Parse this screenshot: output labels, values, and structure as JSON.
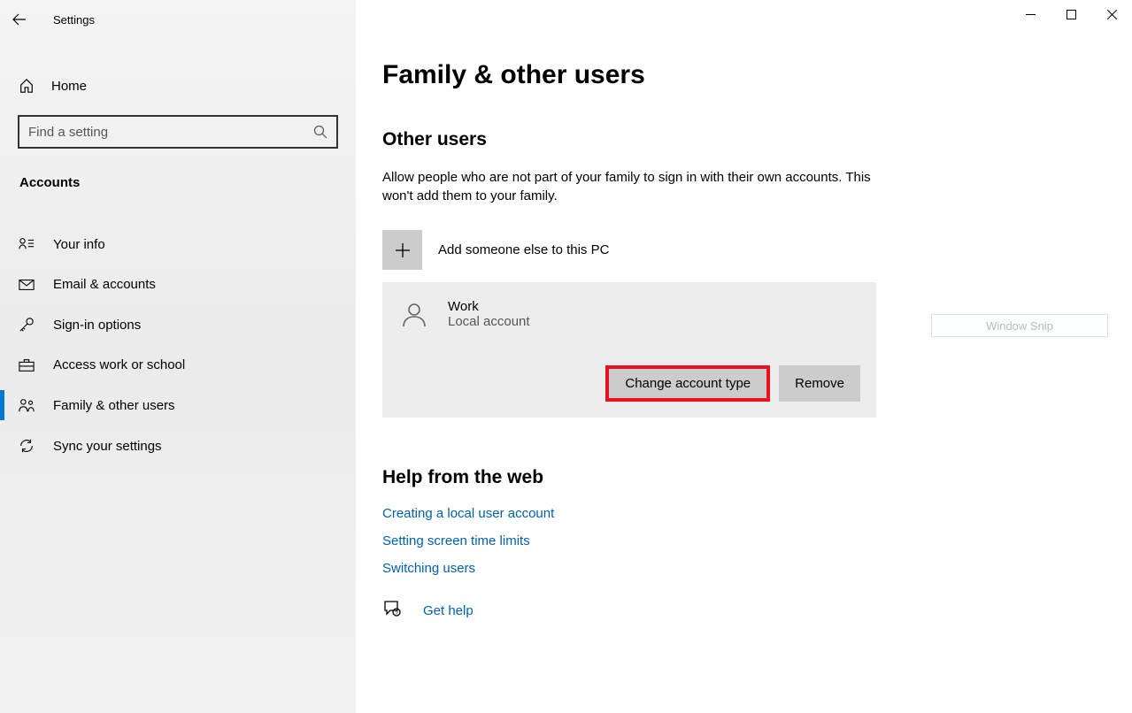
{
  "app": {
    "title": "Settings"
  },
  "sidebar": {
    "home_label": "Home",
    "search_placeholder": "Find a setting",
    "category": "Accounts",
    "items": [
      {
        "label": "Your info",
        "icon": "user-list"
      },
      {
        "label": "Email & accounts",
        "icon": "mail"
      },
      {
        "label": "Sign-in options",
        "icon": "key"
      },
      {
        "label": "Access work or school",
        "icon": "briefcase"
      },
      {
        "label": "Family & other users",
        "icon": "people"
      },
      {
        "label": "Sync your settings",
        "icon": "sync"
      }
    ]
  },
  "page": {
    "title": "Family & other users",
    "other_users_heading": "Other users",
    "other_users_desc": "Allow people who are not part of your family to sign in with their own accounts. This won't add them to your family.",
    "add_label": "Add someone else to this PC",
    "user": {
      "name": "Work",
      "type": "Local account",
      "change_btn": "Change account type",
      "remove_btn": "Remove"
    },
    "snip_label": "Window Snip",
    "help_heading": "Help from the web",
    "help_links": [
      "Creating a local user account",
      "Setting screen time limits",
      "Switching users"
    ],
    "get_help": "Get help"
  }
}
